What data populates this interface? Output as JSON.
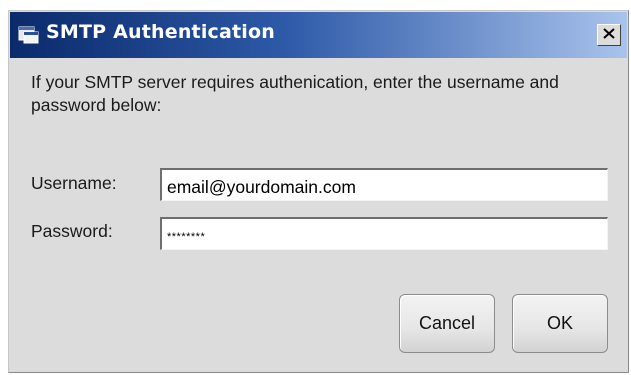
{
  "window": {
    "title": "SMTP Authentication",
    "close_glyph": "✕",
    "icon": "app-window-icon"
  },
  "message": "If your SMTP server requires authenication, enter the username and password below:",
  "fields": {
    "username_label": "Username:",
    "username_value": "email@yourdomain.com",
    "password_label": "Password:",
    "password_value": "********"
  },
  "buttons": {
    "cancel": "Cancel",
    "ok": "OK"
  },
  "colors": {
    "titlebar_start": "#0a2a6b",
    "titlebar_end": "#a9c3ec",
    "dialog_bg": "#dcdcdc"
  }
}
